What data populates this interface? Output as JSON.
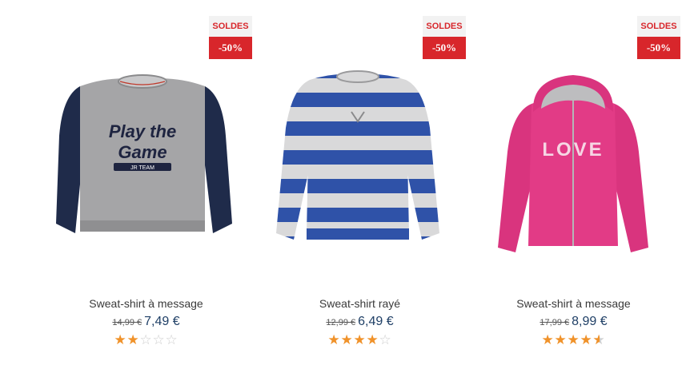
{
  "products": [
    {
      "badge_label": "SOLDES",
      "discount": "-50%",
      "name": "Sweat-shirt à message",
      "old_price": "14,99 €",
      "new_price": "7,49 €",
      "rating": 2,
      "rating_max": 5,
      "image_icon": "gray-navy-raglan-sweatshirt-play-the-game",
      "image_text_1": "Play the",
      "image_text_2": "Game",
      "image_text_3": "JR TEAM"
    },
    {
      "badge_label": "SOLDES",
      "discount": "-50%",
      "name": "Sweat-shirt rayé",
      "old_price": "12,99 €",
      "new_price": "6,49 €",
      "rating": 4,
      "rating_max": 5,
      "image_icon": "blue-gray-striped-sweatshirt"
    },
    {
      "badge_label": "SOLDES",
      "discount": "-50%",
      "name": "Sweat-shirt à message",
      "old_price": "17,99 €",
      "new_price": "8,99 €",
      "rating": 4.5,
      "rating_max": 5,
      "image_icon": "pink-zip-hoodie-love",
      "image_text_1": "LOVE"
    }
  ],
  "colors": {
    "badge_red": "#d8262b",
    "star_orange": "#f0922a",
    "price_blue": "#1f3f66"
  }
}
